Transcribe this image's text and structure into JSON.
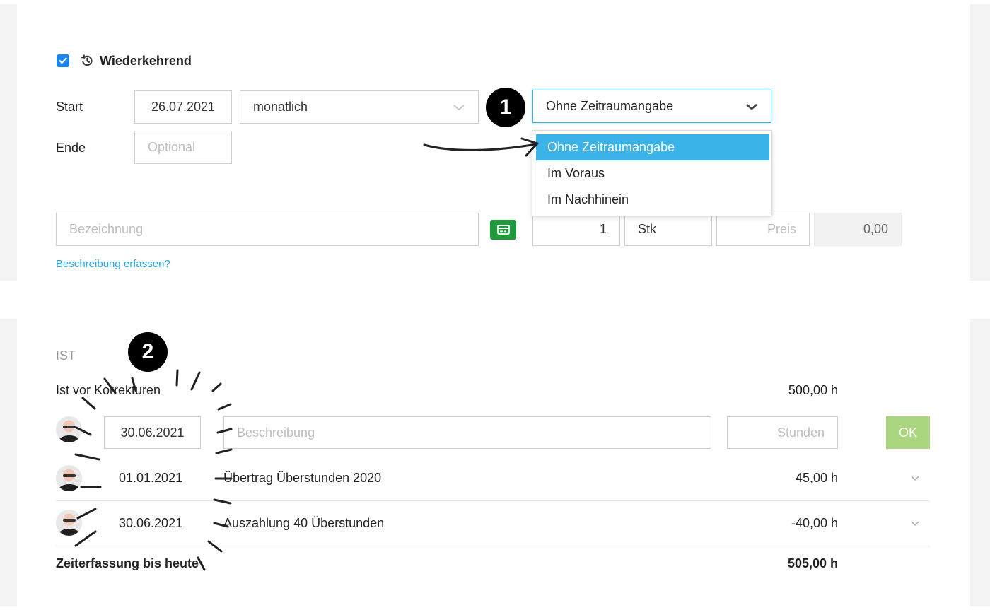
{
  "recurring": {
    "checked": true,
    "icon": "history-icon",
    "label": "Wiederkehrend"
  },
  "schedule": {
    "start_label": "Start",
    "start_date": "26.07.2021",
    "interval": "monatlich",
    "end_label": "Ende",
    "end_placeholder": "Optional",
    "period_select": {
      "value": "Ohne Zeitraumangabe",
      "options": [
        "Ohne Zeitraumangabe",
        "Im Voraus",
        "Im Nachhinein"
      ],
      "selected_index": 0
    }
  },
  "item": {
    "name_placeholder": "Bezeichnung",
    "card_icon": "credit-card-icon",
    "quantity": "1",
    "unit": "Stk",
    "price_placeholder": "Preis",
    "total": "0,00",
    "description_link": "Beschreibung erfassen?"
  },
  "annotations": {
    "badge1": "1",
    "badge2": "2"
  },
  "ist": {
    "title": "IST",
    "before_corrections_label": "Ist vor Korrekturen",
    "before_corrections_value": "500,00 h",
    "new_entry": {
      "date": "30.06.2021",
      "description_placeholder": "Beschreibung",
      "hours_placeholder": "Stunden",
      "ok_label": "OK"
    },
    "entries": [
      {
        "date": "01.01.2021",
        "description": "Übertrag Überstunden 2020",
        "hours": "45,00 h"
      },
      {
        "date": "30.06.2021",
        "description": "Auszahlung 40 Überstunden",
        "hours": "-40,00 h"
      }
    ],
    "total_label": "Zeiterfassung bis heute",
    "total_value": "505,00 h"
  },
  "colors": {
    "accent_blue": "#3bb3e8",
    "checkbox_blue": "#1a84f0",
    "ok_green": "#a9d67e",
    "card_green": "#1e9a3c",
    "link_blue": "#2aa7e0"
  }
}
